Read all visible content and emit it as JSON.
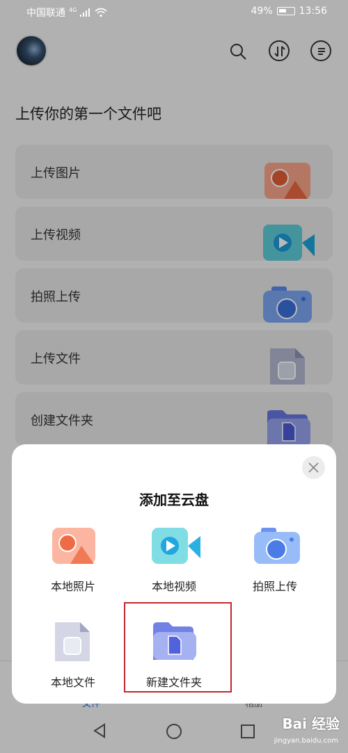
{
  "status_bar": {
    "carrier": "中国联通",
    "network": "4G",
    "battery": "49%",
    "time": "13:56"
  },
  "header": {
    "title": "上传你的第一个文件吧"
  },
  "cards": [
    {
      "label": "上传图片"
    },
    {
      "label": "上传视频"
    },
    {
      "label": "拍照上传"
    },
    {
      "label": "上传文件"
    },
    {
      "label": "创建文件夹"
    }
  ],
  "tabs": [
    {
      "label": "文件"
    },
    {
      "label": "相册"
    }
  ],
  "sheet": {
    "title": "添加至云盘",
    "options": [
      {
        "label": "本地照片",
        "icon": "photo-icon"
      },
      {
        "label": "本地视频",
        "icon": "video-icon"
      },
      {
        "label": "拍照上传",
        "icon": "camera-icon"
      },
      {
        "label": "本地文件",
        "icon": "file-icon"
      },
      {
        "label": "新建文件夹",
        "icon": "folder-icon"
      }
    ]
  },
  "watermark": {
    "text": "Bai 经验",
    "sub": "jingyan.baidu.com"
  },
  "colors": {
    "highlight": "#c2272d",
    "accent": "#1d6ae5"
  }
}
